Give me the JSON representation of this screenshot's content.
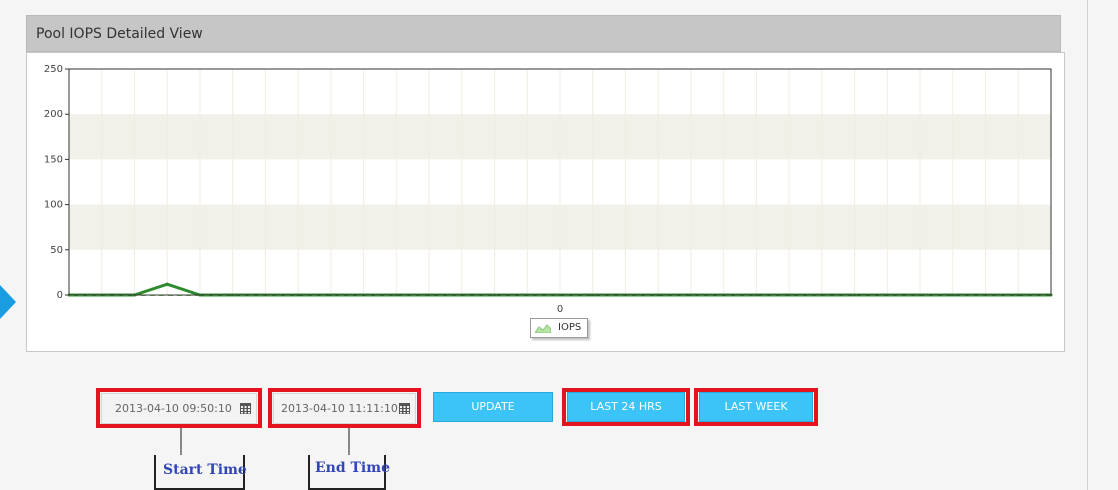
{
  "panel": {
    "title": "Pool IOPS Detailed View"
  },
  "chart_data": {
    "type": "line",
    "title": "",
    "xlabel": "",
    "ylabel": "",
    "ylim": [
      0,
      250
    ],
    "yticks": [
      "0",
      "50",
      "100",
      "150",
      "200",
      "250"
    ],
    "xtick_labels": [
      "0"
    ],
    "grid": true,
    "legend": "bottom-center",
    "series": [
      {
        "name": "IOPS",
        "color": "#2e8b2e",
        "values": [
          0,
          0,
          0,
          12,
          0,
          0,
          0,
          0,
          0,
          0,
          0,
          0,
          0,
          0,
          0,
          0,
          0,
          0,
          0,
          0,
          0,
          0,
          0,
          0,
          0,
          0,
          0,
          0,
          0,
          0,
          0
        ]
      }
    ]
  },
  "controls": {
    "start_time": "2013-04-10 09:50:10",
    "end_time": "2013-04-10 11:11:10",
    "update_label": "UPDATE",
    "last24_label": "LAST 24 HRS",
    "lastweek_label": "LAST WEEK"
  },
  "annotations": {
    "start_label": "Start Time",
    "end_label": "End Time"
  },
  "colors": {
    "accent": "#3cc3f7",
    "highlight": "#e3141f",
    "series": "#2e8b2e"
  }
}
